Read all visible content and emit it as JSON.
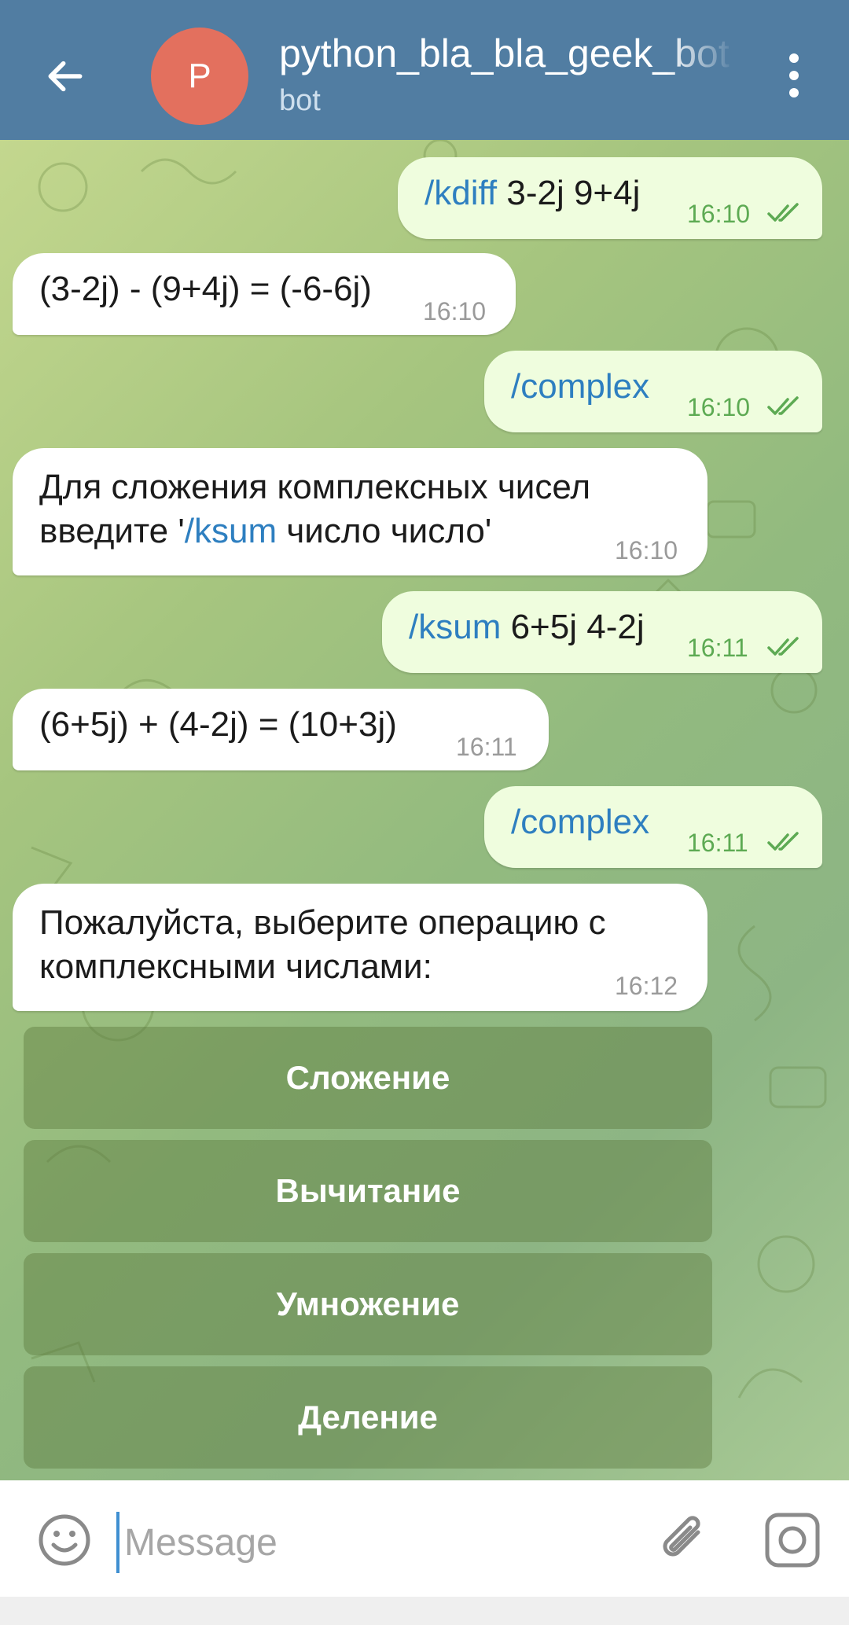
{
  "header": {
    "title": "python_bla_bla_geek_bot",
    "subtitle": "bot",
    "avatar_letter": "P",
    "avatar_color": "#e3705e",
    "bar_color": "#517da2",
    "back_icon": "arrow-left-icon",
    "menu_icon": "more-vertical-icon"
  },
  "messages": [
    {
      "dir": "out",
      "cmd": "/kdiff",
      "text": " 3-2j 9+4j",
      "time": "16:10",
      "read": true
    },
    {
      "dir": "in",
      "text": "(3-2j) - (9+4j) = (-6-6j)",
      "time": "16:10"
    },
    {
      "dir": "out",
      "cmd": "/complex",
      "text": "",
      "time": "16:10",
      "read": true
    },
    {
      "dir": "in",
      "line1": "Для сложения комплексных чисел",
      "line2_pre": "введите '",
      "line2_cmd": "/ksum",
      "line2_post": " число число'",
      "time": "16:10"
    },
    {
      "dir": "out",
      "cmd": "/ksum",
      "text": " 6+5j 4-2j",
      "time": "16:11",
      "read": true
    },
    {
      "dir": "in",
      "text": "(6+5j) + (4-2j) = (10+3j)",
      "time": "16:11"
    },
    {
      "dir": "out",
      "cmd": "/complex",
      "text": "",
      "time": "16:11",
      "read": true
    },
    {
      "dir": "in",
      "line1": "Пожалуйста, выберите операцию с",
      "line2": "комплексными числами:",
      "time": "16:12"
    }
  ],
  "keyboard": {
    "buttons": [
      "Сложение",
      "Вычитание",
      "Умножение",
      "Деление"
    ]
  },
  "input": {
    "placeholder": "Message",
    "emoji_icon": "smile-icon",
    "attach_icon": "paperclip-icon",
    "camera_icon": "camera-icon"
  },
  "colors": {
    "outgoing_bubble": "#effdde",
    "incoming_bubble": "#ffffff",
    "command_link": "#2e7fc0",
    "read_ticks": "#5daa53"
  }
}
